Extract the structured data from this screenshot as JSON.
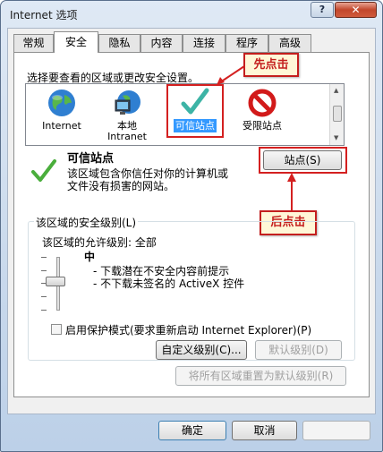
{
  "window": {
    "title": "Internet 选项",
    "help": "?",
    "close": "✕"
  },
  "tabs": [
    {
      "label": "常规"
    },
    {
      "label": "安全"
    },
    {
      "label": "隐私"
    },
    {
      "label": "内容"
    },
    {
      "label": "连接"
    },
    {
      "label": "程序"
    },
    {
      "label": "高级"
    }
  ],
  "security": {
    "prompt": "选择要查看的区域或更改安全设置。",
    "zones": [
      {
        "label": "Internet",
        "icon": "globe-icon"
      },
      {
        "label": "本地",
        "label2": "Intranet",
        "icon": "local-network-icon"
      },
      {
        "label": "可信站点",
        "icon": "checkmark-icon"
      },
      {
        "label": "受限站点",
        "icon": "restricted-icon"
      }
    ],
    "selected_zone": "可信站点",
    "zone_title": "可信站点",
    "zone_desc_1": "该区域包含你信任对你的计算机或",
    "zone_desc_2": "文件没有损害的网站。",
    "sites_button": "站点(S)",
    "level_group": "该区域的安全级别(L)",
    "allowed_levels": "该区域的允许级别: 全部",
    "level_name": "中",
    "level_desc_1": "- 下载潜在不安全内容前提示",
    "level_desc_2": "- 不下载未签名的 ActiveX 控件",
    "protected_mode": "启用保护模式(要求重新启动 Internet Explorer)(P)",
    "custom_level": "自定义级别(C)...",
    "default_level": "默认级别(D)",
    "reset_all": "将所有区域重置为默认级别(R)"
  },
  "annotations": {
    "first": "先点击",
    "second": "后点击"
  },
  "footer": {
    "ok": "确定",
    "cancel": "取消"
  },
  "colors": {
    "highlight": "#3399ff",
    "annotation_red": "#c41e1e"
  }
}
